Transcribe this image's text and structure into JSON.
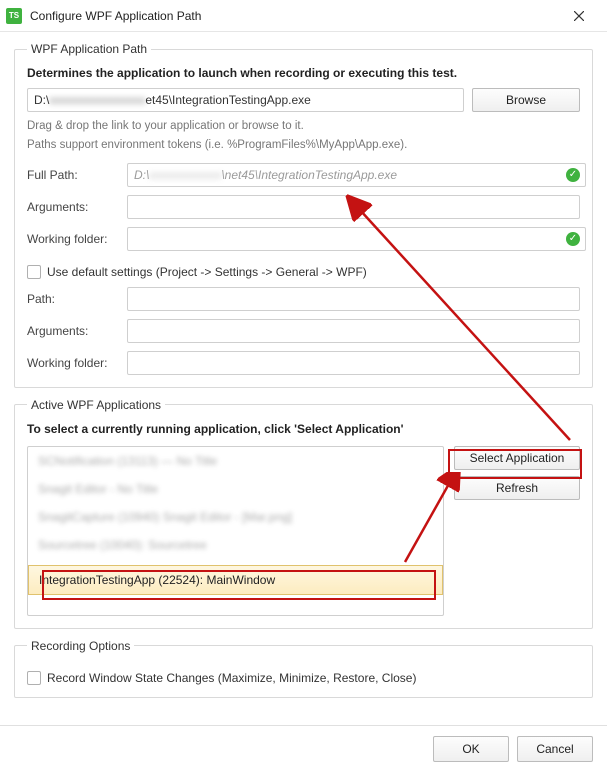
{
  "title": "Configure WPF Application Path",
  "group_path": {
    "legend": "WPF Application Path",
    "desc": "Determines the application to launch when recording or executing this test.",
    "path_prefix": "D:\\",
    "path_suffix": "et45\\IntegrationTestingApp.exe",
    "browse": "Browse",
    "helper1": "Drag & drop the link to your application or browse to it.",
    "helper2": "Paths support environment tokens (i.e. %ProgramFiles%\\MyApp\\App.exe).",
    "full_path_label": "Full Path:",
    "full_path_prefix": "D:\\",
    "full_path_suffix": "\\net45\\IntegrationTestingApp.exe",
    "arguments_label": "Arguments:",
    "arguments_value": "",
    "working_label": "Working folder:",
    "working_value": "",
    "use_default": "Use default settings (Project -> Settings -> General -> WPF)",
    "path2_label": "Path:",
    "path2_value": "",
    "arguments2_label": "Arguments:",
    "arguments2_value": "",
    "working2_label": "Working folder:",
    "working2_value": ""
  },
  "group_active": {
    "legend": "Active WPF Applications",
    "desc": "To select a currently running application, click 'Select Application'",
    "items": {
      "i0": "SCNotification (13113) — No Title",
      "i1": "Snagit Editor - No Title",
      "i2": "SnagitCapture (10940) Snagit Editor - [Mar.png]",
      "i3": "Sourcetree (10040): Sourcetree",
      "sel": "IntegrationTestingApp (22524): MainWindow"
    },
    "select_app": "Select Application",
    "refresh": "Refresh"
  },
  "group_rec": {
    "legend": "Recording Options",
    "record_changes": "Record Window State Changes (Maximize, Minimize, Restore, Close)"
  },
  "footer": {
    "ok": "OK",
    "cancel": "Cancel"
  }
}
